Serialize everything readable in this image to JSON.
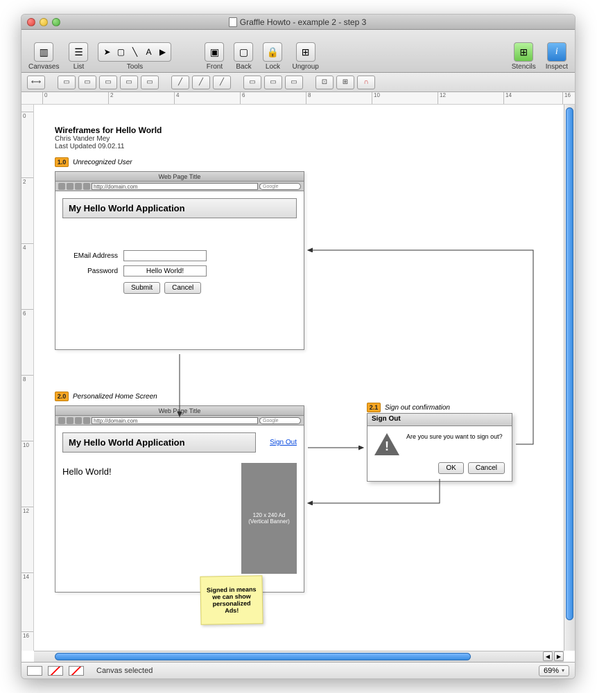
{
  "window": {
    "title": "Graffle Howto - example 2 - step 3"
  },
  "toolbar": {
    "canvases": "Canvases",
    "list": "List",
    "tools": "Tools",
    "front": "Front",
    "back": "Back",
    "lock": "Lock",
    "ungroup": "Ungroup",
    "stencils": "Stencils",
    "inspect": "Inspect"
  },
  "ruler": {
    "h": [
      "0",
      "2",
      "4",
      "6",
      "8",
      "10",
      "12",
      "14",
      "16"
    ],
    "v": [
      "0",
      "2",
      "4",
      "6",
      "8",
      "10",
      "12",
      "14",
      "16"
    ]
  },
  "status": {
    "text": "Canvas selected",
    "zoom": "69%"
  },
  "doc": {
    "title": "Wireframes for Hello World",
    "author": "Chris Vander Mey",
    "updated": "Last Updated 09.02.11",
    "step1": {
      "num": "1.0",
      "label": "Unrecognized User"
    },
    "step2": {
      "num": "2.0",
      "label": "Personalized Home Screen"
    },
    "step21": {
      "num": "2.1",
      "label": "Sign out confirmation"
    },
    "browser": {
      "pageTitle": "Web Page Title",
      "url": "http://domain.com",
      "search": "Google",
      "appTitle": "My Hello World Application",
      "emailLabel": "EMail Address",
      "passwordLabel": "Password",
      "passwordValue": "Hello World!",
      "submit": "Submit",
      "cancel": "Cancel"
    },
    "home": {
      "signOut": "Sign Out",
      "hello": "Hello World!",
      "ad": "120 x 240 Ad (Vertical Banner)"
    },
    "sticky": "Signed in means we can show personalized Ads!",
    "dialog": {
      "title": "Sign Out",
      "msg": "Are you sure you want to sign out?",
      "ok": "OK",
      "cancel": "Cancel"
    }
  }
}
